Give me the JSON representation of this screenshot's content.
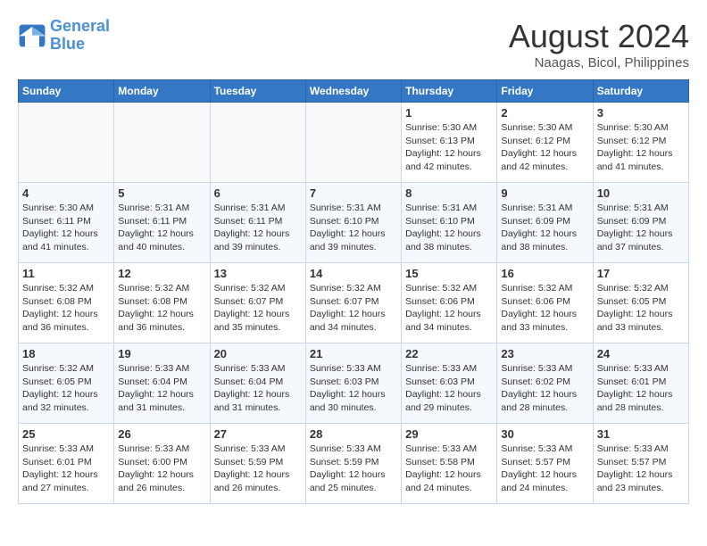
{
  "logo": {
    "line1": "General",
    "line2": "Blue"
  },
  "title": "August 2024",
  "location": "Naagas, Bicol, Philippines",
  "days_of_week": [
    "Sunday",
    "Monday",
    "Tuesday",
    "Wednesday",
    "Thursday",
    "Friday",
    "Saturday"
  ],
  "weeks": [
    [
      {
        "day": "",
        "info": ""
      },
      {
        "day": "",
        "info": ""
      },
      {
        "day": "",
        "info": ""
      },
      {
        "day": "",
        "info": ""
      },
      {
        "day": "1",
        "info": "Sunrise: 5:30 AM\nSunset: 6:13 PM\nDaylight: 12 hours\nand 42 minutes."
      },
      {
        "day": "2",
        "info": "Sunrise: 5:30 AM\nSunset: 6:12 PM\nDaylight: 12 hours\nand 42 minutes."
      },
      {
        "day": "3",
        "info": "Sunrise: 5:30 AM\nSunset: 6:12 PM\nDaylight: 12 hours\nand 41 minutes."
      }
    ],
    [
      {
        "day": "4",
        "info": "Sunrise: 5:30 AM\nSunset: 6:11 PM\nDaylight: 12 hours\nand 41 minutes."
      },
      {
        "day": "5",
        "info": "Sunrise: 5:31 AM\nSunset: 6:11 PM\nDaylight: 12 hours\nand 40 minutes."
      },
      {
        "day": "6",
        "info": "Sunrise: 5:31 AM\nSunset: 6:11 PM\nDaylight: 12 hours\nand 39 minutes."
      },
      {
        "day": "7",
        "info": "Sunrise: 5:31 AM\nSunset: 6:10 PM\nDaylight: 12 hours\nand 39 minutes."
      },
      {
        "day": "8",
        "info": "Sunrise: 5:31 AM\nSunset: 6:10 PM\nDaylight: 12 hours\nand 38 minutes."
      },
      {
        "day": "9",
        "info": "Sunrise: 5:31 AM\nSunset: 6:09 PM\nDaylight: 12 hours\nand 38 minutes."
      },
      {
        "day": "10",
        "info": "Sunrise: 5:31 AM\nSunset: 6:09 PM\nDaylight: 12 hours\nand 37 minutes."
      }
    ],
    [
      {
        "day": "11",
        "info": "Sunrise: 5:32 AM\nSunset: 6:08 PM\nDaylight: 12 hours\nand 36 minutes."
      },
      {
        "day": "12",
        "info": "Sunrise: 5:32 AM\nSunset: 6:08 PM\nDaylight: 12 hours\nand 36 minutes."
      },
      {
        "day": "13",
        "info": "Sunrise: 5:32 AM\nSunset: 6:07 PM\nDaylight: 12 hours\nand 35 minutes."
      },
      {
        "day": "14",
        "info": "Sunrise: 5:32 AM\nSunset: 6:07 PM\nDaylight: 12 hours\nand 34 minutes."
      },
      {
        "day": "15",
        "info": "Sunrise: 5:32 AM\nSunset: 6:06 PM\nDaylight: 12 hours\nand 34 minutes."
      },
      {
        "day": "16",
        "info": "Sunrise: 5:32 AM\nSunset: 6:06 PM\nDaylight: 12 hours\nand 33 minutes."
      },
      {
        "day": "17",
        "info": "Sunrise: 5:32 AM\nSunset: 6:05 PM\nDaylight: 12 hours\nand 33 minutes."
      }
    ],
    [
      {
        "day": "18",
        "info": "Sunrise: 5:32 AM\nSunset: 6:05 PM\nDaylight: 12 hours\nand 32 minutes."
      },
      {
        "day": "19",
        "info": "Sunrise: 5:33 AM\nSunset: 6:04 PM\nDaylight: 12 hours\nand 31 minutes."
      },
      {
        "day": "20",
        "info": "Sunrise: 5:33 AM\nSunset: 6:04 PM\nDaylight: 12 hours\nand 31 minutes."
      },
      {
        "day": "21",
        "info": "Sunrise: 5:33 AM\nSunset: 6:03 PM\nDaylight: 12 hours\nand 30 minutes."
      },
      {
        "day": "22",
        "info": "Sunrise: 5:33 AM\nSunset: 6:03 PM\nDaylight: 12 hours\nand 29 minutes."
      },
      {
        "day": "23",
        "info": "Sunrise: 5:33 AM\nSunset: 6:02 PM\nDaylight: 12 hours\nand 28 minutes."
      },
      {
        "day": "24",
        "info": "Sunrise: 5:33 AM\nSunset: 6:01 PM\nDaylight: 12 hours\nand 28 minutes."
      }
    ],
    [
      {
        "day": "25",
        "info": "Sunrise: 5:33 AM\nSunset: 6:01 PM\nDaylight: 12 hours\nand 27 minutes."
      },
      {
        "day": "26",
        "info": "Sunrise: 5:33 AM\nSunset: 6:00 PM\nDaylight: 12 hours\nand 26 minutes."
      },
      {
        "day": "27",
        "info": "Sunrise: 5:33 AM\nSunset: 5:59 PM\nDaylight: 12 hours\nand 26 minutes."
      },
      {
        "day": "28",
        "info": "Sunrise: 5:33 AM\nSunset: 5:59 PM\nDaylight: 12 hours\nand 25 minutes."
      },
      {
        "day": "29",
        "info": "Sunrise: 5:33 AM\nSunset: 5:58 PM\nDaylight: 12 hours\nand 24 minutes."
      },
      {
        "day": "30",
        "info": "Sunrise: 5:33 AM\nSunset: 5:57 PM\nDaylight: 12 hours\nand 24 minutes."
      },
      {
        "day": "31",
        "info": "Sunrise: 5:33 AM\nSunset: 5:57 PM\nDaylight: 12 hours\nand 23 minutes."
      }
    ]
  ]
}
